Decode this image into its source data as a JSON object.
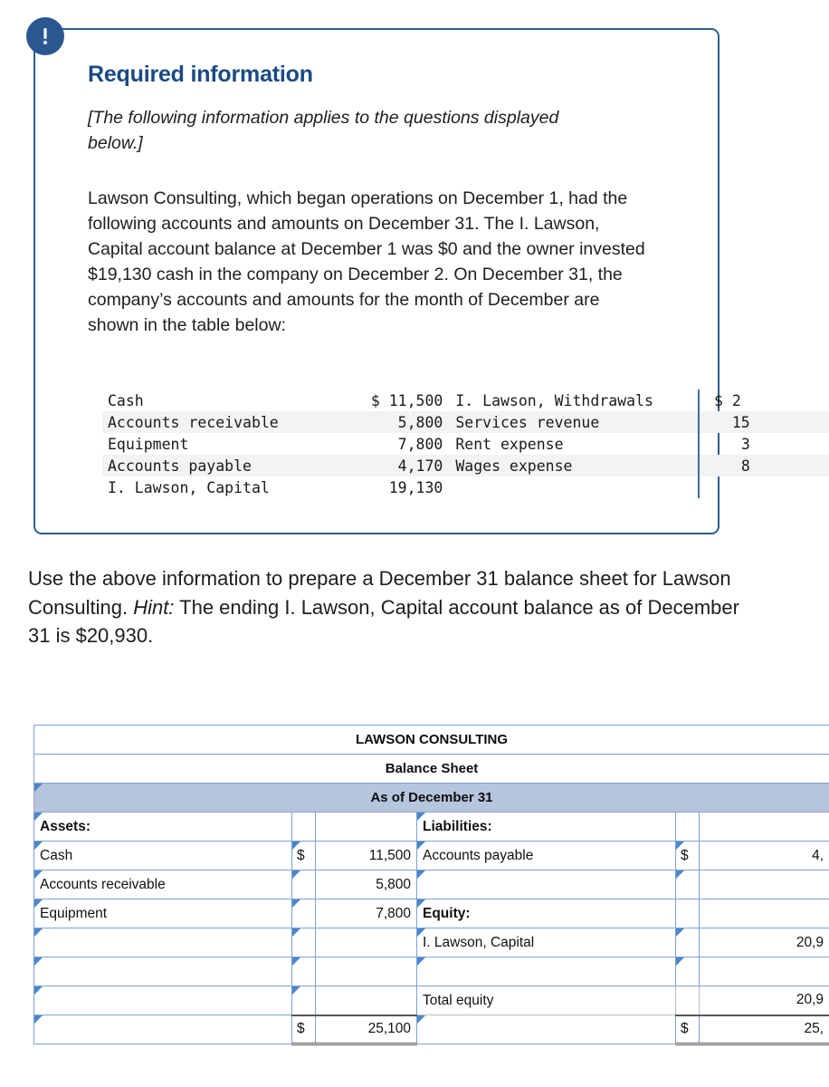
{
  "card": {
    "icon": "exclamation-icon",
    "title": "Required information",
    "italic_note": "[The following information applies to the questions displayed below.]",
    "body": "Lawson Consulting, which began operations on December 1, had the following accounts and amounts on December 31. The I. Lawson, Capital account balance at December 1 was $0 and the owner invested $19,130 cash in the company on December 2. On December 31, the company’s accounts and amounts for the month of December are shown in the table below:",
    "accounts_table": {
      "rows": [
        {
          "left_name": "Cash",
          "left_dollar": "$",
          "left_amount": "11,500",
          "right_name": "I. Lawson, Withdrawals",
          "right_dollar": "$",
          "right_amount": "2"
        },
        {
          "left_name": "Accounts receivable",
          "left_dollar": "",
          "left_amount": "5,800",
          "right_name": "Services revenue",
          "right_dollar": "",
          "right_amount": "15"
        },
        {
          "left_name": "Equipment",
          "left_dollar": "",
          "left_amount": "7,800",
          "right_name": "Rent expense",
          "right_dollar": "",
          "right_amount": "3"
        },
        {
          "left_name": "Accounts payable",
          "left_dollar": "",
          "left_amount": "4,170",
          "right_name": "Wages expense",
          "right_dollar": "",
          "right_amount": "8"
        },
        {
          "left_name": "I. Lawson, Capital",
          "left_dollar": "",
          "left_amount": "19,130",
          "right_name": "",
          "right_dollar": "",
          "right_amount": ""
        }
      ]
    }
  },
  "prompt": {
    "part1": "Use the above information to prepare a December 31 balance sheet for Lawson Consulting. ",
    "hint_label": "Hint:",
    "part2": " The ending I. Lawson, Capital account balance as of December 31 is $20,930."
  },
  "balance_sheet": {
    "company": "LAWSON CONSULTING",
    "statement": "Balance Sheet",
    "period": "As of December 31",
    "rows": [
      {
        "d1": "Assets:",
        "bold1": true,
        "c1": "",
        "v1": "",
        "d2": "Liabilities:",
        "bold2": true,
        "c2": "",
        "v2": ""
      },
      {
        "d1": "Cash",
        "bold1": false,
        "c1": "$",
        "v1": "11,500",
        "d2": "Accounts payable",
        "bold2": false,
        "c2": "$",
        "v2": "4,"
      },
      {
        "d1": "Accounts receivable",
        "bold1": false,
        "c1": "",
        "v1": "5,800",
        "d2": "",
        "bold2": false,
        "c2": "",
        "v2": ""
      },
      {
        "d1": "Equipment",
        "bold1": false,
        "c1": "",
        "v1": "7,800",
        "d2": "Equity:",
        "bold2": true,
        "c2": "",
        "v2": ""
      },
      {
        "d1": "",
        "bold1": false,
        "c1": "",
        "v1": "",
        "d2": "I. Lawson, Capital",
        "bold2": false,
        "c2": "",
        "v2": "20,9"
      },
      {
        "d1": "",
        "bold1": false,
        "c1": "",
        "v1": "",
        "d2": "",
        "bold2": false,
        "c2": "",
        "v2": ""
      },
      {
        "d1": "",
        "bold1": false,
        "c1": "",
        "v1": "",
        "d2": "Total equity",
        "bold2": false,
        "c2": "",
        "v2": "20,9"
      },
      {
        "d1": "",
        "bold1": false,
        "c1": "$",
        "v1": "25,100",
        "d2": "",
        "bold2": false,
        "c2": "$",
        "v2": "25,"
      }
    ]
  },
  "colors": {
    "card_border": "#2e5d93",
    "icon_bg": "#2a5790",
    "heading": "#1b4a82",
    "table_header_blue": "#76a7e3",
    "table_header_light": "#b6c5de",
    "cell_border": "#7ba3d4",
    "marker": "#4e86c9"
  }
}
